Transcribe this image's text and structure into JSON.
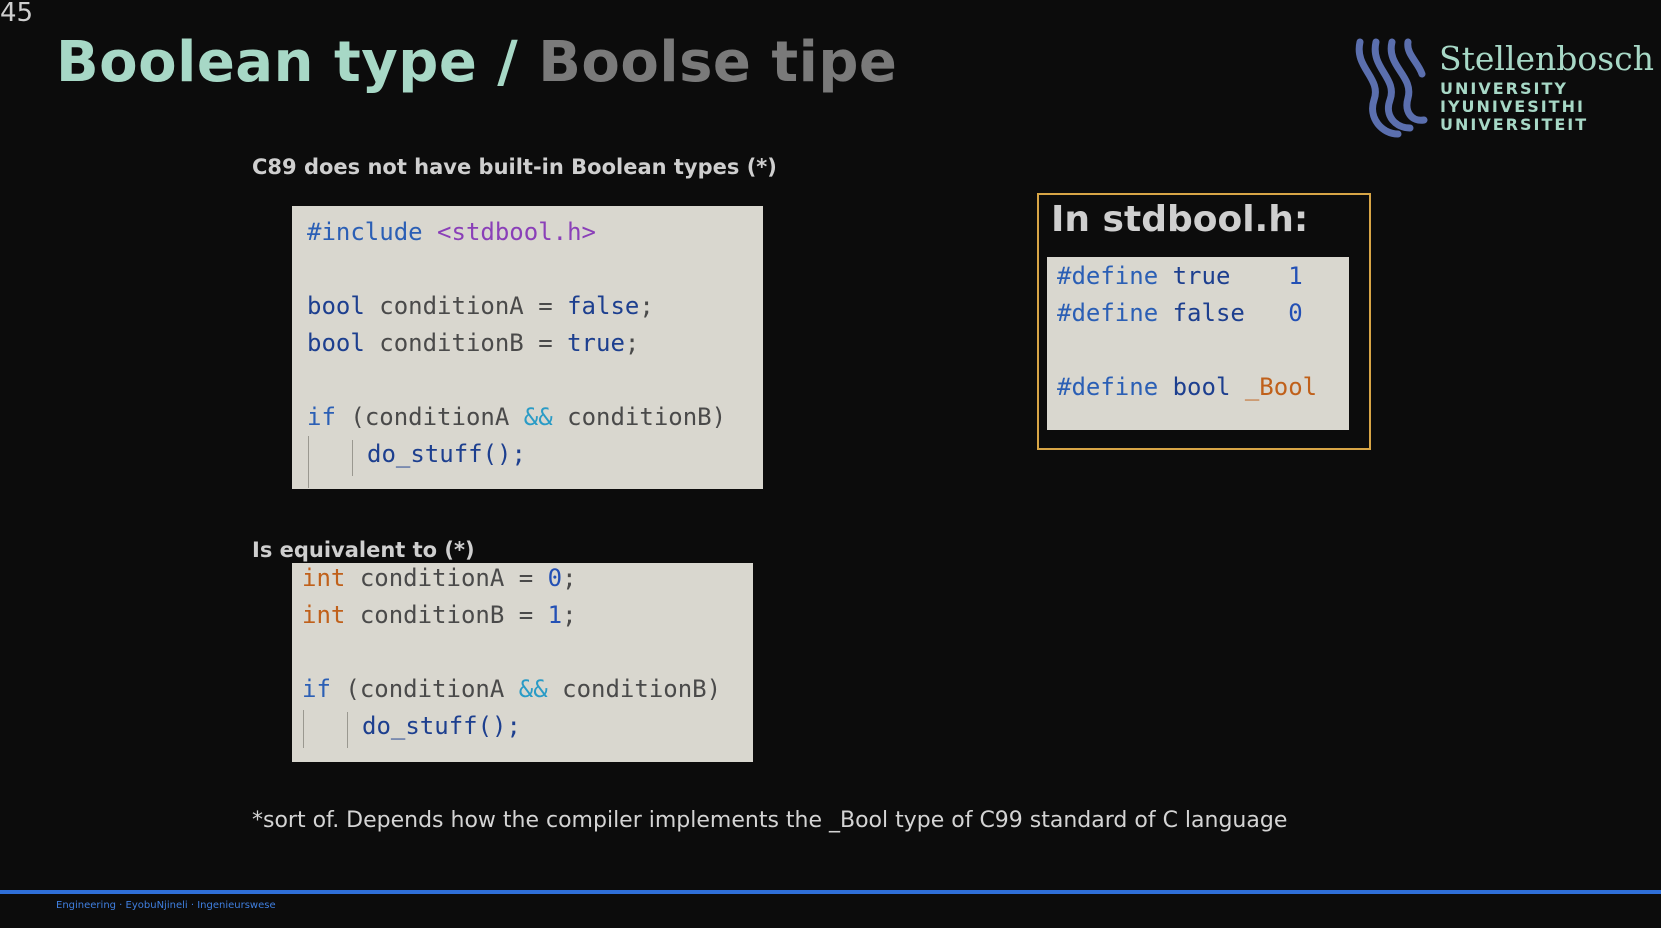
{
  "slide_number": "45",
  "title": {
    "english": "Boolean type",
    "separator": "/",
    "afrikaans": "Boolse tipe"
  },
  "logo": {
    "name": "Stellenbosch",
    "line1": "UNIVERSITY",
    "line2": "IYUNIVESITHI",
    "line3": "UNIVERSITEIT",
    "color": "#a7d8c6",
    "mark_color": "#5b6fae"
  },
  "labels": {
    "c89": "C89 does not have built-in Boolean types (*)",
    "equivalent": "Is equivalent to (*)"
  },
  "code1": {
    "include_kw": "#include",
    "include_file": "<stdbool.h>",
    "type": "bool",
    "varA": "conditionA",
    "varB": "conditionB",
    "assign": "=",
    "false_val": "false",
    "true_val": "true",
    "semi": ";",
    "if_kw": "if",
    "open": "(",
    "and_op": "&&",
    "close": ")",
    "call": "do_stuff();"
  },
  "code2": {
    "type": "int",
    "varA": "conditionA",
    "varB": "conditionB",
    "assign": "=",
    "zero": "0",
    "one": "1",
    "semi": ";",
    "if_kw": "if",
    "open": "(",
    "and_op": "&&",
    "close": ")",
    "call": "do_stuff();"
  },
  "stdbool": {
    "heading": "In stdbool.h:",
    "define_kw": "#define",
    "true_name": "true",
    "true_val": "1",
    "false_name": "false",
    "false_val": "0",
    "bool_name": "bool",
    "bool_val": "_Bool"
  },
  "footnote": "*sort of. Depends how the compiler implements the _Bool type of C99 standard of C language",
  "footer": "Engineering · EyobuNjineli · Ingenieurswese",
  "colors": {
    "accent_green": "#a7d8c6",
    "footer_blue": "#2f6fd8",
    "box_border": "#d7a546",
    "code_bg": "#d9d7cf"
  }
}
